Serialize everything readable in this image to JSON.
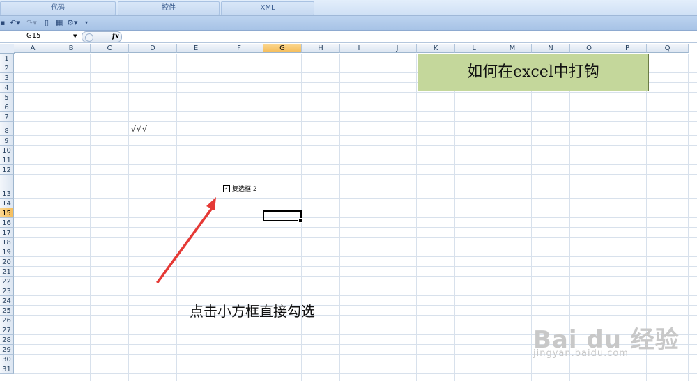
{
  "ribbon": {
    "groups": [
      "代码",
      "控件",
      "XML"
    ]
  },
  "formula_bar": {
    "name_box": "G15",
    "fx_label": "fx",
    "formula": ""
  },
  "sheet": {
    "columns": [
      "A",
      "B",
      "C",
      "D",
      "E",
      "F",
      "G",
      "H",
      "I",
      "J",
      "K",
      "L",
      "M",
      "N",
      "O",
      "P",
      "Q"
    ],
    "rows": [
      "1",
      "2",
      "3",
      "4",
      "5",
      "6",
      "7",
      "8",
      "9",
      "10",
      "11",
      "12",
      "13",
      "14",
      "15",
      "16",
      "17",
      "18",
      "19",
      "20",
      "21",
      "22",
      "23",
      "24",
      "25",
      "26",
      "27",
      "28",
      "29",
      "30",
      "31"
    ],
    "selected_column": "G",
    "selected_row": "15",
    "title_text": "如何在excel中打钩",
    "check_marks": "√√√",
    "checkbox": {
      "label": "复选框 2",
      "checked": true,
      "mark": "✓"
    },
    "instruction": "点击小方框直接勾选"
  },
  "watermark": {
    "brand": "Bai du 经验",
    "url": "jingyan.baidu.com"
  },
  "colors": {
    "title_fill": "#c4d79b",
    "arrow": "#e53935",
    "selection_header": "#f5bd5a"
  }
}
